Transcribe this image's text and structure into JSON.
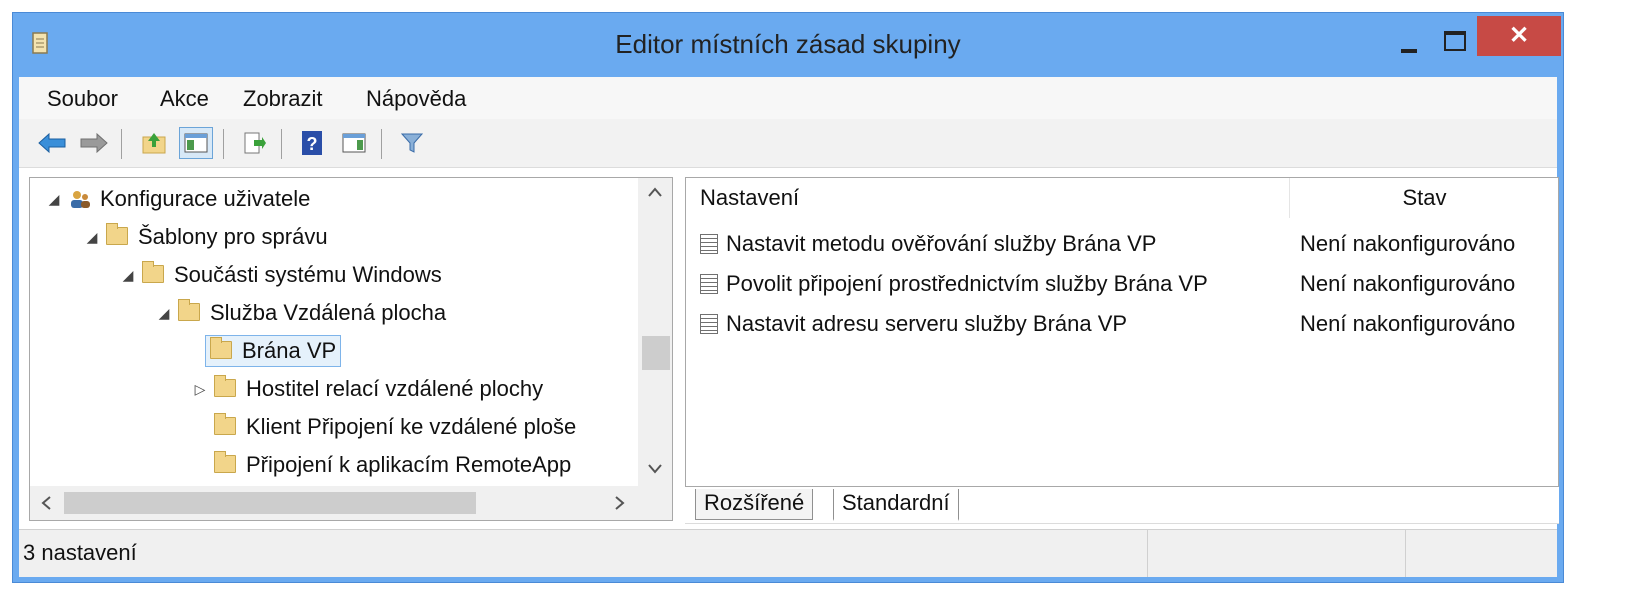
{
  "window": {
    "title": "Editor místních zásad skupiny",
    "close_glyph": "✕"
  },
  "menu": {
    "items": [
      "Soubor",
      "Akce",
      "Zobrazit",
      "Nápověda"
    ]
  },
  "toolbar": {
    "icons": [
      "back-arrow-icon",
      "forward-arrow-icon",
      "up-folder-icon",
      "show-hide-tree-icon",
      "export-list-icon",
      "help-icon",
      "show-action-pane-icon",
      "filter-icon"
    ]
  },
  "tree": {
    "items": [
      {
        "label": "Konfigurace uživatele",
        "expander": "◢"
      },
      {
        "label": "Šablony pro správu",
        "expander": "◢"
      },
      {
        "label": "Součásti systému Windows",
        "expander": "◢"
      },
      {
        "label": "Služba Vzdálená plocha",
        "expander": "◢"
      },
      {
        "label": "Brána VP",
        "expander": ""
      },
      {
        "label": "Hostitel relací vzdálené plochy",
        "expander": "▷"
      },
      {
        "label": "Klient Připojení ke vzdálené ploše",
        "expander": ""
      },
      {
        "label": "Připojení k aplikacím RemoteApp",
        "expander": ""
      }
    ]
  },
  "list": {
    "columns": [
      "Nastavení",
      "Stav"
    ],
    "rows": [
      {
        "name": "Nastavit metodu ověřování služby Brána VP",
        "state": "Není nakonfigurováno"
      },
      {
        "name": "Povolit připojení prostřednictvím služby Brána VP",
        "state": "Není nakonfigurováno"
      },
      {
        "name": "Nastavit adresu serveru služby Brána VP",
        "state": "Není nakonfigurováno"
      }
    ]
  },
  "tabs": [
    "Rozšířené",
    "Standardní"
  ],
  "status": {
    "text": "3 nastavení"
  },
  "colors": {
    "titlebar": "#6aaaf0",
    "close_button": "#c74a45",
    "selection": "#e5f1fb"
  }
}
